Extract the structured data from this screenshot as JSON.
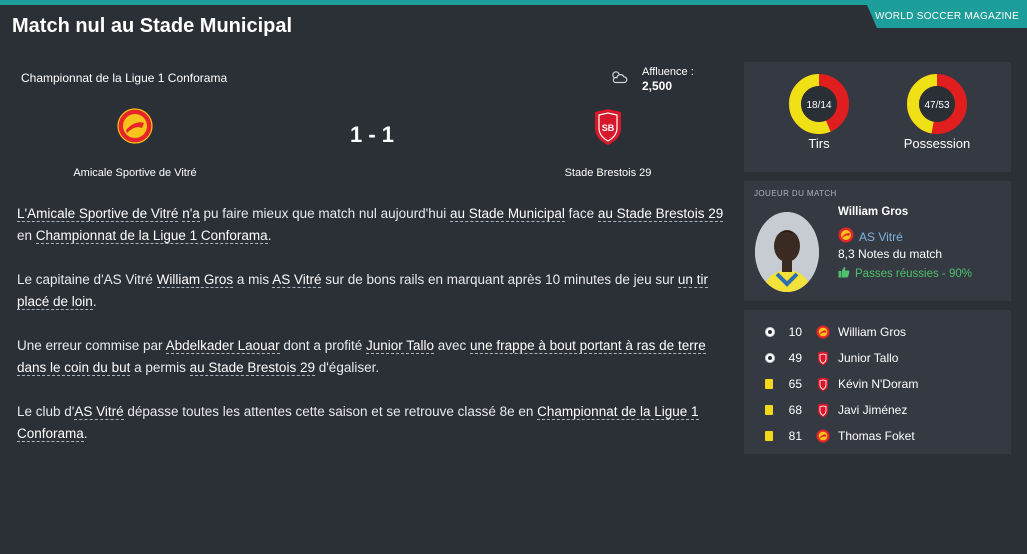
{
  "magazine": "WORLD SOCCER MAGAZINE",
  "title": "Match nul au Stade Municipal",
  "match": {
    "competition": "Championnat de la Ligue 1 Conforama",
    "attendance_label": "Affluence :",
    "attendance_value": "2,500",
    "score": "1 - 1",
    "home_team": "Amicale Sportive de Vitré",
    "away_team": "Stade Brestois 29",
    "weather_icon": "partly-cloudy-icon"
  },
  "article": {
    "p1": [
      {
        "t": "L'Amicale Sportive de Vitré",
        "link": true
      },
      {
        "t": " ",
        "link": false
      },
      {
        "t": "n'a",
        "link": true
      },
      {
        "t": " pu faire mieux que match nul aujourd'hui ",
        "link": false
      },
      {
        "t": "au Stade Municipal",
        "link": true
      },
      {
        "t": " face ",
        "link": false
      },
      {
        "t": "au Stade Brestois 29",
        "link": true
      },
      {
        "t": " en ",
        "link": false
      },
      {
        "t": "Championnat de la Ligue 1 Conforama",
        "link": true
      },
      {
        "t": ".",
        "link": false
      }
    ],
    "p2": [
      {
        "t": "Le capitaine d'AS Vitré ",
        "link": false
      },
      {
        "t": "William Gros",
        "link": true
      },
      {
        "t": " a mis ",
        "link": false
      },
      {
        "t": "AS Vitré",
        "link": true
      },
      {
        "t": " sur de bons rails en marquant après 10 minutes de jeu sur ",
        "link": false
      },
      {
        "t": "un tir placé de loin",
        "link": true
      },
      {
        "t": ".",
        "link": false
      }
    ],
    "p3": [
      {
        "t": "Une erreur commise par ",
        "link": false
      },
      {
        "t": "Abdelkader Laouar",
        "link": true
      },
      {
        "t": " dont a profité ",
        "link": false
      },
      {
        "t": "Junior Tallo",
        "link": true
      },
      {
        "t": " avec ",
        "link": false
      },
      {
        "t": "une frappe à bout portant à ras de terre dans le coin du but",
        "link": true
      },
      {
        "t": " a permis ",
        "link": false
      },
      {
        "t": "au Stade Brestois 29",
        "link": true
      },
      {
        "t": " d'égaliser.",
        "link": false
      }
    ],
    "p4": [
      {
        "t": "Le club d'",
        "link": false
      },
      {
        "t": "AS Vitré",
        "link": true
      },
      {
        "t": " dépasse toutes les attentes cette saison et se retrouve classé 8e en ",
        "link": false
      },
      {
        "t": "Championnat de la Ligue 1 Conforama",
        "link": true
      },
      {
        "t": ".",
        "link": false
      }
    ]
  },
  "stats": {
    "shots": {
      "home": 18,
      "away": 14,
      "text": "18/14",
      "label": "Tirs"
    },
    "possession": {
      "home": 47,
      "away": 53,
      "text": "47/53",
      "label": "Possession"
    },
    "colors": {
      "home": "#f0e016",
      "away": "#e01e1e",
      "inner": "#2a2e35"
    }
  },
  "motm": {
    "header": "JOUEUR DU MATCH",
    "name": "William Gros",
    "club": "AS Vitré",
    "rating": "8,3",
    "rating_label": "Notes du match",
    "passes": "Passes réussies - 90%",
    "passes_icon": "thumbs-up-icon"
  },
  "events": [
    {
      "type": "goal",
      "icon": "ball-icon",
      "minute": "10",
      "team": "home",
      "player": "William Gros"
    },
    {
      "type": "goal",
      "icon": "ball-icon",
      "minute": "49",
      "team": "away",
      "player": "Junior Tallo"
    },
    {
      "type": "yellow",
      "icon": "yellow-card-icon",
      "minute": "65",
      "team": "away",
      "player": "Kévin N'Doram"
    },
    {
      "type": "yellow",
      "icon": "yellow-card-icon",
      "minute": "68",
      "team": "away",
      "player": "Javi Jiménez"
    },
    {
      "type": "yellow",
      "icon": "yellow-card-icon",
      "minute": "81",
      "team": "home",
      "player": "Thomas Foket"
    }
  ]
}
